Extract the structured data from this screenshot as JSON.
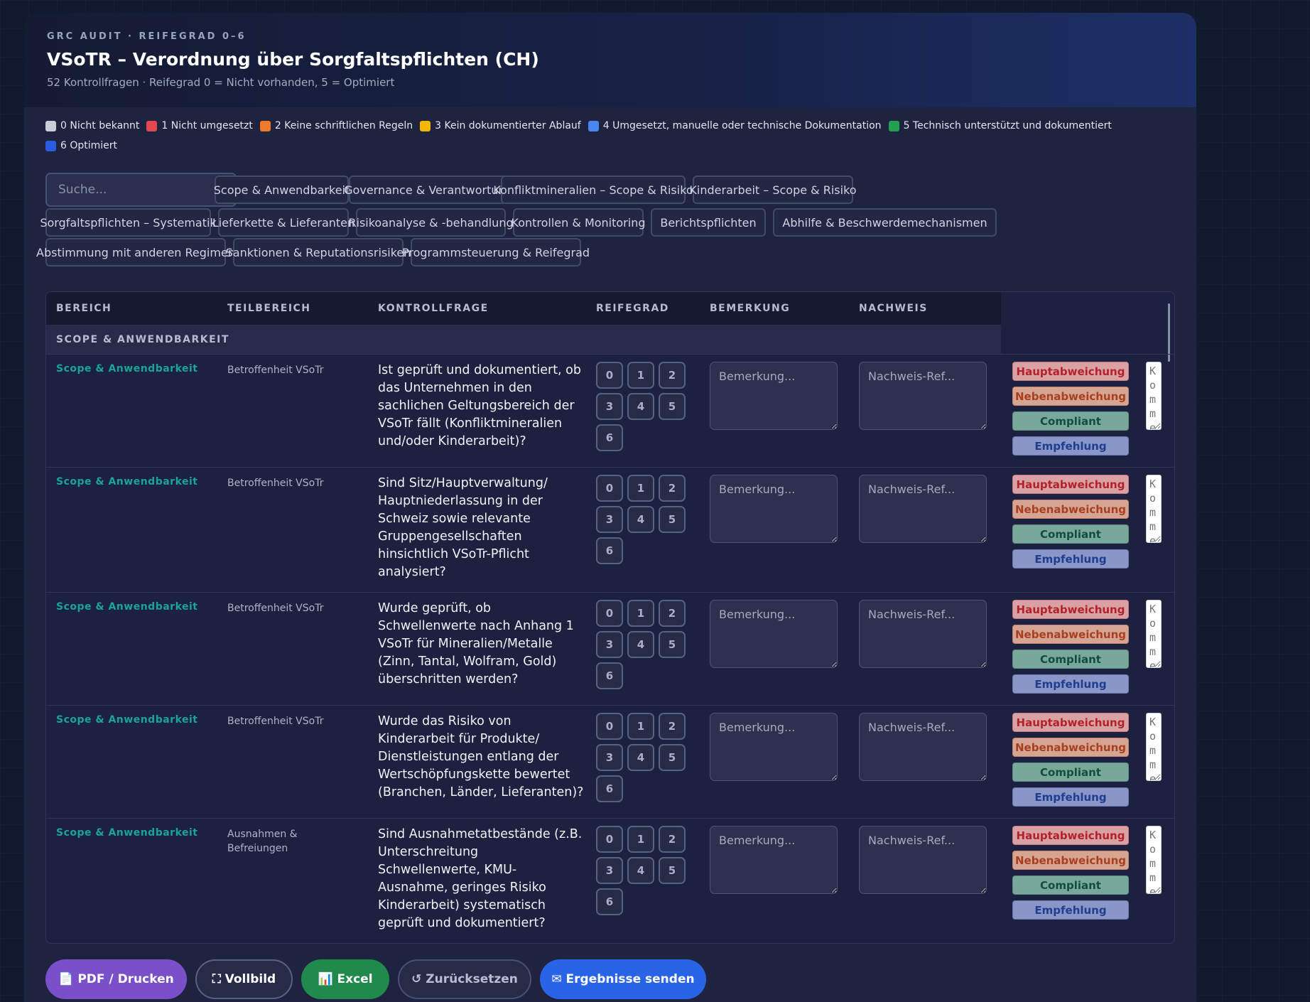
{
  "header": {
    "eyebrow": "GRC AUDIT · REIFEGRAD 0–6",
    "title": "VSoTR – Verordnung über Sorgfaltspflichten (CH)",
    "subtitle": "52 Kontrollfragen · Reifegrad 0 = Nicht vorhanden, 5 = Optimiert"
  },
  "legend": [
    {
      "label": "0 Nicht bekannt",
      "color": "#c9cdd8"
    },
    {
      "label": "1 Nicht umgesetzt",
      "color": "#e5484d"
    },
    {
      "label": "2 Keine schriftlichen Regeln",
      "color": "#f07a2a"
    },
    {
      "label": "3 Kein dokumentierter Ablauf",
      "color": "#f2b705"
    },
    {
      "label": "4 Umgesetzt, manuelle oder technische Dokumentation",
      "color": "#4a86f0"
    },
    {
      "label": "5 Technisch unterstützt und dokumentiert",
      "color": "#22a04f"
    },
    {
      "label": "6 Optimiert",
      "color": "#2a5be0"
    }
  ],
  "search": {
    "placeholder": "Suche..."
  },
  "filters": [
    "Scope & Anwendbarkeit",
    "Governance & Verantwortung",
    "Konfliktmineralien – Scope & Risiko",
    "Kinderarbeit – Scope & Risiko",
    "Sorgfaltspflichten – Systematik",
    "Lieferkette & Lieferanten",
    "Risikoanalyse & -behandlung",
    "Kontrollen & Monitoring",
    "Berichtspflichten",
    "Abhilfe & Beschwerdemechanismen",
    "Abstimmung mit anderen Regimen",
    "Sanktionen & Reputationsrisiken",
    "Programmsteuerung & Reifegrad"
  ],
  "table": {
    "columns": [
      "BEREICH",
      "TEILBEREICH",
      "KONTROLLFRAGE",
      "REIFEGRAD",
      "BEMERKUNG",
      "NACHWEIS"
    ],
    "group": "SCOPE & ANWENDBARKEIT",
    "score_options": [
      "0",
      "1",
      "2",
      "3",
      "4",
      "5",
      "6"
    ],
    "remark_placeholder": "Bemerkung...",
    "evidence_placeholder": "Nachweis-Ref...",
    "comment_placeholder": "Kommentar",
    "tags": [
      "Hauptabweichung",
      "Nebenabweichung",
      "Compliant",
      "Empfehlung"
    ],
    "rows": [
      {
        "area": "Scope & Anwendbarkeit",
        "sub": "Betroffenheit VSoTr",
        "question": "Ist geprüft und dokumentiert, ob das Unternehmen in den sachlichen Geltungsbereich der VSoTr fällt (Konfliktmineralien und/oder Kinderarbeit)?"
      },
      {
        "area": "Scope & Anwendbarkeit",
        "sub": "Betroffenheit VSoTr",
        "question": "Sind Sitz/Hauptverwaltung/ Hauptniederlassung in der Schweiz sowie relevante Gruppengesellschaften hinsichtlich VSoTr-Pflicht analysiert?"
      },
      {
        "area": "Scope & Anwendbarkeit",
        "sub": "Betroffenheit VSoTr",
        "question": "Wurde geprüft, ob Schwellenwerte nach Anhang 1 VSoTr für Mineralien/Metalle (Zinn, Tantal, Wolfram, Gold) überschritten werden?"
      },
      {
        "area": "Scope & Anwendbarkeit",
        "sub": "Betroffenheit VSoTr",
        "question": "Wurde das Risiko von Kinderarbeit für Produkte/ Dienstleistungen entlang der Wertschöpfungskette bewertet (Branchen, Länder, Lieferanten)?"
      },
      {
        "area": "Scope & Anwendbarkeit",
        "sub": "Ausnahmen & Befreiungen",
        "question": "Sind Ausnahmetatbestände (z.B. Unterschreitung Schwellenwerte, KMU-Ausnahme, geringes Risiko Kinderarbeit) systematisch geprüft und dokumentiert?"
      }
    ]
  },
  "actions": {
    "pdf": "📄 PDF / Drucken",
    "fullscreen": "⛶ Vollbild",
    "excel": "📊 Excel",
    "reset": "↺ Zurücksetzen",
    "send": "✉ Ergebnisse senden"
  }
}
